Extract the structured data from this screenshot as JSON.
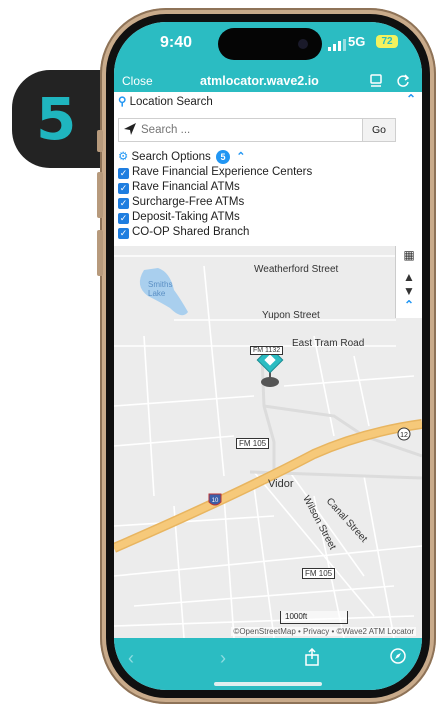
{
  "step": "5",
  "status": {
    "time": "9:40",
    "network": "5G",
    "battery": "72"
  },
  "toolbar": {
    "close_label": "Close",
    "url": "atmlocator.wave2.io"
  },
  "location_search": {
    "title": "Location Search",
    "placeholder": "Search ...",
    "go_label": "Go"
  },
  "search_options": {
    "title": "Search Options",
    "count": "5",
    "items": [
      {
        "label": "Rave Financial Experience Centers",
        "checked": true
      },
      {
        "label": "Rave Financial ATMs",
        "checked": true
      },
      {
        "label": "Surcharge-Free ATMs",
        "checked": true
      },
      {
        "label": "Deposit-Taking ATMs",
        "checked": true
      },
      {
        "label": "CO-OP Shared Branch",
        "checked": true
      }
    ]
  },
  "map": {
    "labels": {
      "weatherford": "Weatherford Street",
      "smiths_lake": "Smiths Lake",
      "yupon": "Yupon Street",
      "east_tram": "East Tram Road",
      "fm1132": "FM 1132",
      "fm105_a": "FM 105",
      "route12": "12",
      "vidor": "Vidor",
      "route10": "10",
      "canal": "Canal Street",
      "wilson": "Wilson Street",
      "fm105_b": "FM 105"
    },
    "scale": "1000ft",
    "attribution": "©OpenStreetMap • Privacy • ©Wave2 ATM Locator"
  },
  "colors": {
    "brand": "#2bbcc2",
    "accent": "#2196f3",
    "highway": "#f6c97a"
  }
}
